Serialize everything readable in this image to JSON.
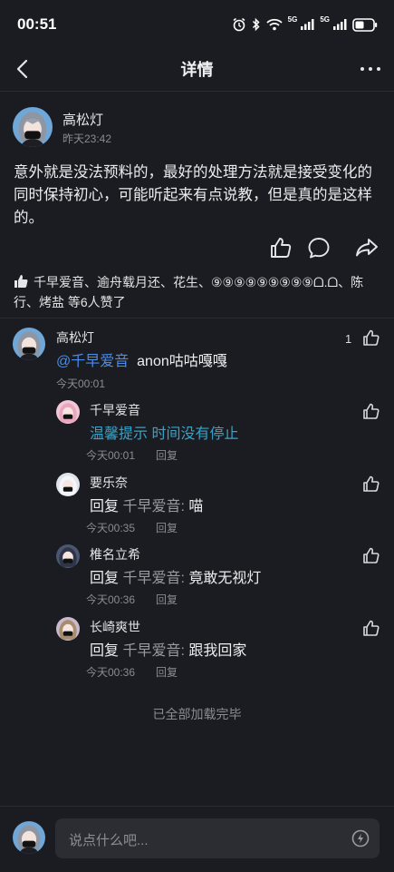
{
  "status_bar": {
    "time": "00:51",
    "network_labels": [
      "5G",
      "5G"
    ],
    "icons": [
      "alarm-icon",
      "bluetooth-icon",
      "wifi-icon",
      "signal-icon",
      "signal-icon",
      "battery-icon"
    ]
  },
  "header": {
    "title": "详情",
    "back_icon": "back-arrow-icon",
    "more_icon": "more-icon"
  },
  "post": {
    "author": "高松灯",
    "time": "昨天23:42",
    "content": "意外就是没法预料的，最好的处理方法就是接受变化的同时保持初心，可能听起来有点说教，但是真的是这样的。",
    "actions": [
      "like-icon",
      "comment-icon",
      "share-icon"
    ],
    "likes_text": "千早爱音、逾舟载月还、花生、⑨⑨⑨⑨⑨⑨⑨⑨⑨ᗝ.ᗝ、陈行、烤盐 等6人赞了"
  },
  "comment": {
    "author": "高松灯",
    "mention": "@千早爱音",
    "text": "anon咕咕嘎嘎",
    "time": "今天00:01",
    "like_count": "1"
  },
  "replies": [
    {
      "author": "千早爱音",
      "prefix": "",
      "target": "",
      "text": "温馨提示 时间没有停止",
      "time": "今天00:01",
      "reply_label": "回复"
    },
    {
      "author": "要乐奈",
      "prefix": "回复",
      "target": "千早爱音:",
      "text": "喵",
      "time": "今天00:35",
      "reply_label": "回复"
    },
    {
      "author": "椎名立希",
      "prefix": "回复",
      "target": "千早爱音:",
      "text": "竟敢无视灯",
      "time": "今天00:36",
      "reply_label": "回复"
    },
    {
      "author": "长崎爽世",
      "prefix": "回复",
      "target": "千早爱音:",
      "text": "跟我回家",
      "time": "今天00:36",
      "reply_label": "回复"
    }
  ],
  "footer": {
    "end_text": "已全部加载完毕",
    "input_placeholder": "说点什么吧...",
    "input_icon": "quick-reply-icon"
  },
  "colors": {
    "background": "#1b1c21",
    "link": "#4b8ce6",
    "tip": "#36a3c9",
    "muted": "#8a8b91"
  }
}
